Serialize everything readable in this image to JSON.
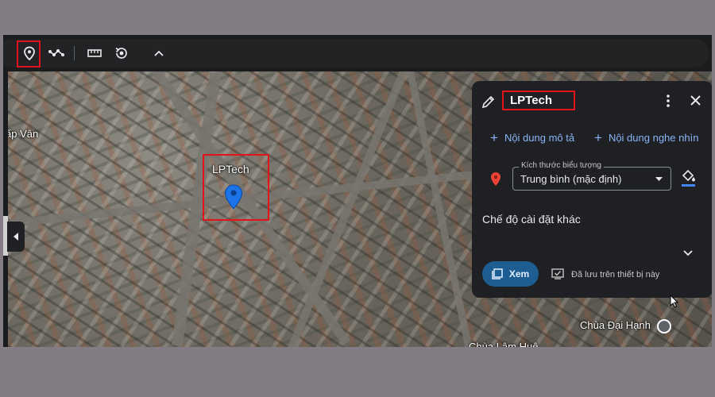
{
  "toolbar": {
    "icons": [
      "location-pin-icon",
      "path-icon",
      "ruler-icon",
      "tour-icon",
      "chevron-up-icon"
    ]
  },
  "map": {
    "labels": {
      "left": "ấp Vân",
      "placemark": "LPTech",
      "bottom_right": "Chùa Đại Hạnh",
      "bottom_cut": "Chùa Lâm Huệ"
    },
    "pin_color": "#1a73e8"
  },
  "panel": {
    "title": "LPTech",
    "add_description": "Nội dung mô tả",
    "add_media": "Nội dung nghe nhìn",
    "icon_size_label": "Kích thước biểu tượng",
    "icon_size_value": "Trung bình (mặc định)",
    "more_settings": "Chế độ cài đặt khác",
    "view_button": "Xem",
    "saved_status": "Đã lưu trên thiết bị này",
    "marker_color": "#ea4335",
    "accent": "#8ab4f8"
  }
}
